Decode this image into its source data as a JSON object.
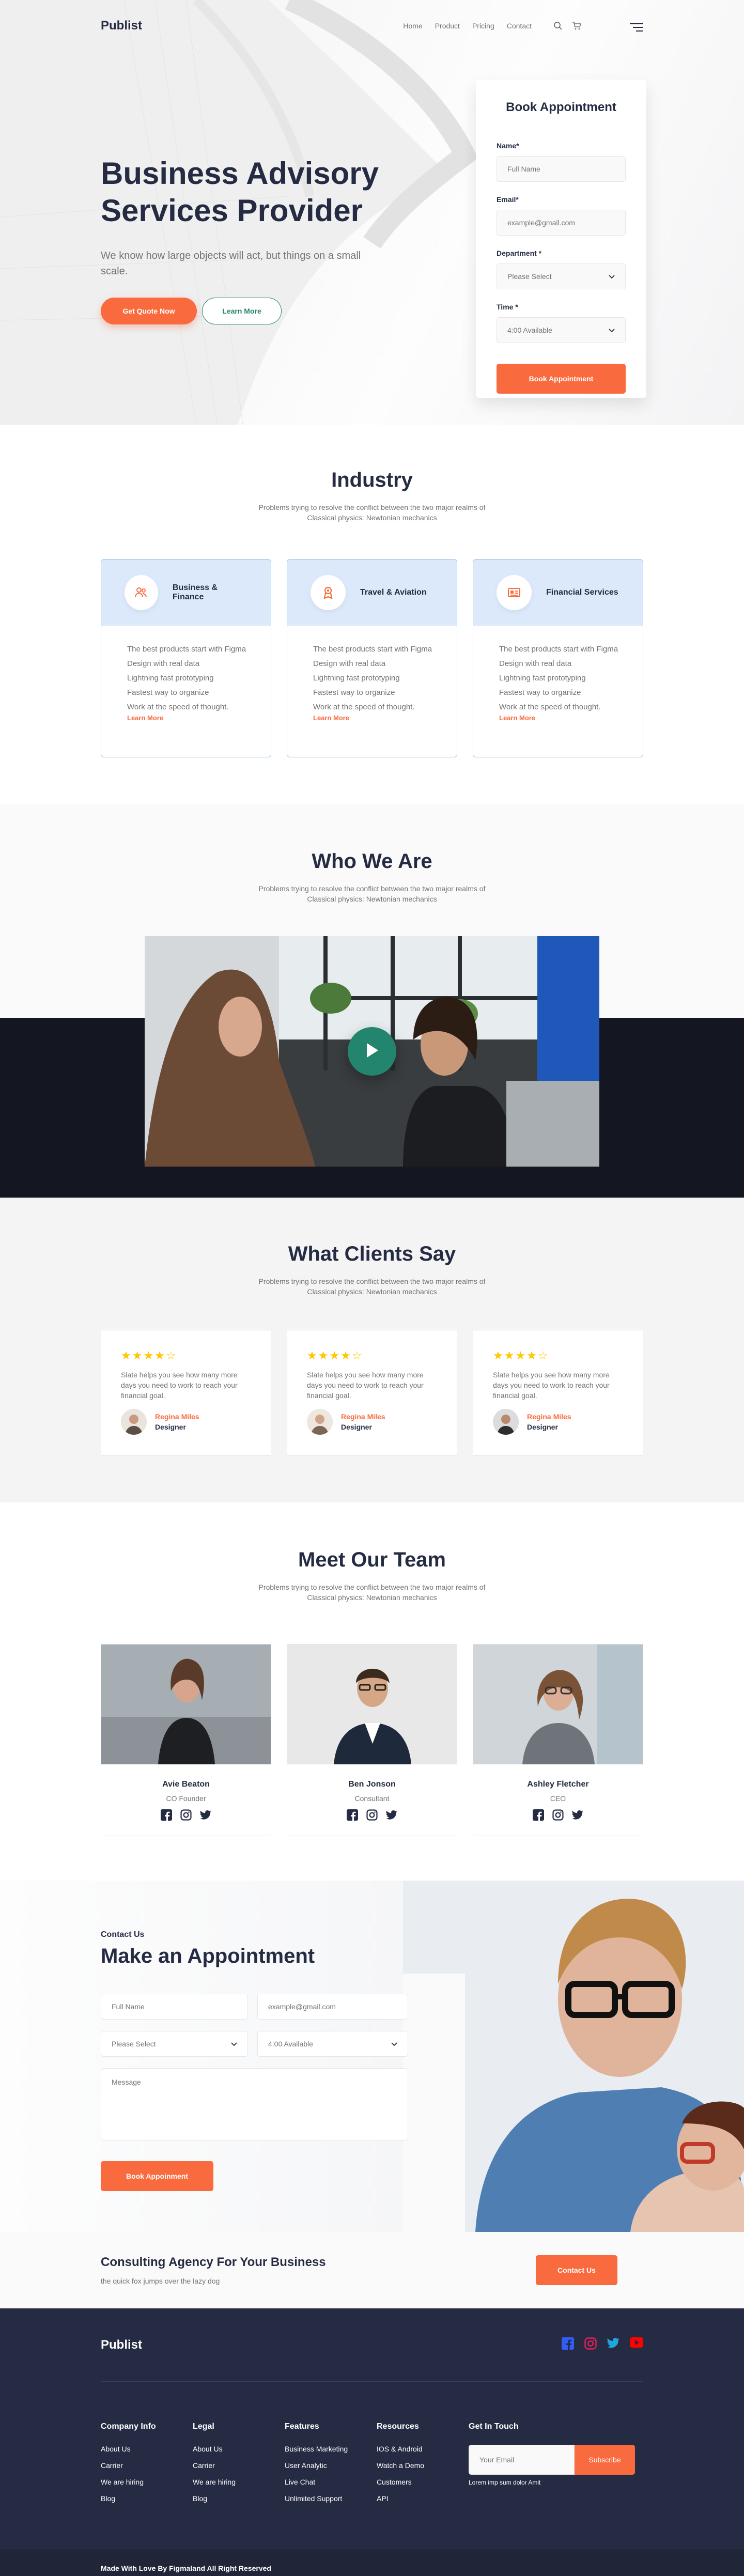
{
  "nav": {
    "brand": "Publist",
    "links": [
      "Home",
      "Product",
      "Pricing",
      "Contact"
    ],
    "icons": [
      "search-icon",
      "cart-icon",
      "menu-icon"
    ]
  },
  "hero": {
    "title_line1": "Business Advisory",
    "title_line2": "Services Provider",
    "subtitle": "We know how large objects will act, but things on a small scale.",
    "primary_btn": "Get Quote Now",
    "secondary_btn": "Learn More"
  },
  "booking": {
    "title": "Book Appointment",
    "name_label": "Name*",
    "name_placeholder": "Full Name",
    "email_label": "Email*",
    "email_placeholder": "example@gmail.com",
    "dept_label": "Department *",
    "dept_value": "Please Select",
    "time_label": "Time *",
    "time_value": "4:00 Available",
    "submit": "Book Appointment"
  },
  "industry": {
    "title": "Industry",
    "subtitle": "Problems trying to resolve the conflict between the two major realms of Classical physics: Newtonian mechanics",
    "cards": [
      {
        "title": "Business & Finance",
        "icon": "users-icon",
        "items": [
          "The best products start with Figma",
          "Design with real data",
          "Lightning fast prototyping",
          "Fastest way to organize",
          "Work at the speed of thought."
        ],
        "link": "Learn More"
      },
      {
        "title": "Travel & Aviation",
        "icon": "award-icon",
        "items": [
          "The best products start with Figma",
          "Design with real data",
          "Lightning fast prototyping",
          "Fastest way to organize",
          "Work at the speed of thought."
        ],
        "link": "Learn More"
      },
      {
        "title": "Financial Services",
        "icon": "newspaper-icon",
        "items": [
          "The best products start with Figma",
          "Design with real data",
          "Lightning fast prototyping",
          "Fastest way to organize",
          "Work at the speed of thought."
        ],
        "link": "Learn More"
      }
    ]
  },
  "who": {
    "title": "Who We Are",
    "subtitle": "Problems trying to resolve the conflict between the two major realms of Classical physics: Newtonian mechanics"
  },
  "clients": {
    "title": "What Clients Say",
    "subtitle": "Problems trying to resolve the conflict between the two major realms of Classical physics: Newtonian mechanics",
    "items": [
      {
        "rating": 4,
        "text": "Slate helps you see how many more days you need to work to reach your financial goal.",
        "name": "Regina Miles",
        "role": "Designer"
      },
      {
        "rating": 4,
        "text": "Slate helps you see how many more days you need to work to reach your financial goal.",
        "name": "Regina Miles",
        "role": "Designer"
      },
      {
        "rating": 4,
        "text": "Slate helps you see how many more days you need to work to reach your financial goal.",
        "name": "Regina Miles",
        "role": "Designer"
      }
    ]
  },
  "team": {
    "title": "Meet Our Team",
    "subtitle": "Problems trying to resolve the conflict between the two major realms of Classical physics: Newtonian mechanics",
    "members": [
      {
        "name": "Avie Beaton",
        "role": "CO Founder"
      },
      {
        "name": "Ben Jonson",
        "role": "Consultant"
      },
      {
        "name": "Ashley Fletcher",
        "role": "CEO"
      }
    ]
  },
  "appointment": {
    "kicker": "Contact Us",
    "title": "Make an Appointment",
    "name_placeholder": "Full Name",
    "email_placeholder": "example@gmail.com",
    "dept_value": "Please Select",
    "time_value": "4:00 Available",
    "message_placeholder": "Message",
    "submit": "Book Appoinment"
  },
  "cta": {
    "title": "Consulting Agency For Your Business",
    "subtitle": "the quick fox jumps over the lazy dog",
    "button": "Contact Us"
  },
  "footer": {
    "brand": "Publist",
    "columns": [
      {
        "title": "Company Info",
        "links": [
          "About Us",
          "Carrier",
          "We are hiring",
          "Blog"
        ]
      },
      {
        "title": "Legal",
        "links": [
          "About Us",
          "Carrier",
          "We are hiring",
          "Blog"
        ]
      },
      {
        "title": "Features",
        "links": [
          "Business Marketing",
          "User Analytic",
          "Live Chat",
          "Unlimited Support"
        ]
      },
      {
        "title": "Resources",
        "links": [
          "IOS & Android",
          "Watch a Demo",
          "Customers",
          "API"
        ]
      }
    ],
    "touch": {
      "title": "Get In Touch",
      "placeholder": "Your Email",
      "button": "Subscribe",
      "note": "Lorem imp sum dolor Amit"
    },
    "copyright": "Made With Love By Figmaland All Right Reserved",
    "colors": {
      "facebook": "#335bf5",
      "instagram": "#e51f5a",
      "twitter": "#21a6df",
      "youtube": "#ff0000"
    }
  },
  "colors": {
    "accent": "#f96b3e",
    "primary": "#252b42",
    "muted": "#737373",
    "success": "#23856d",
    "card_header": "#dbe9fb"
  }
}
